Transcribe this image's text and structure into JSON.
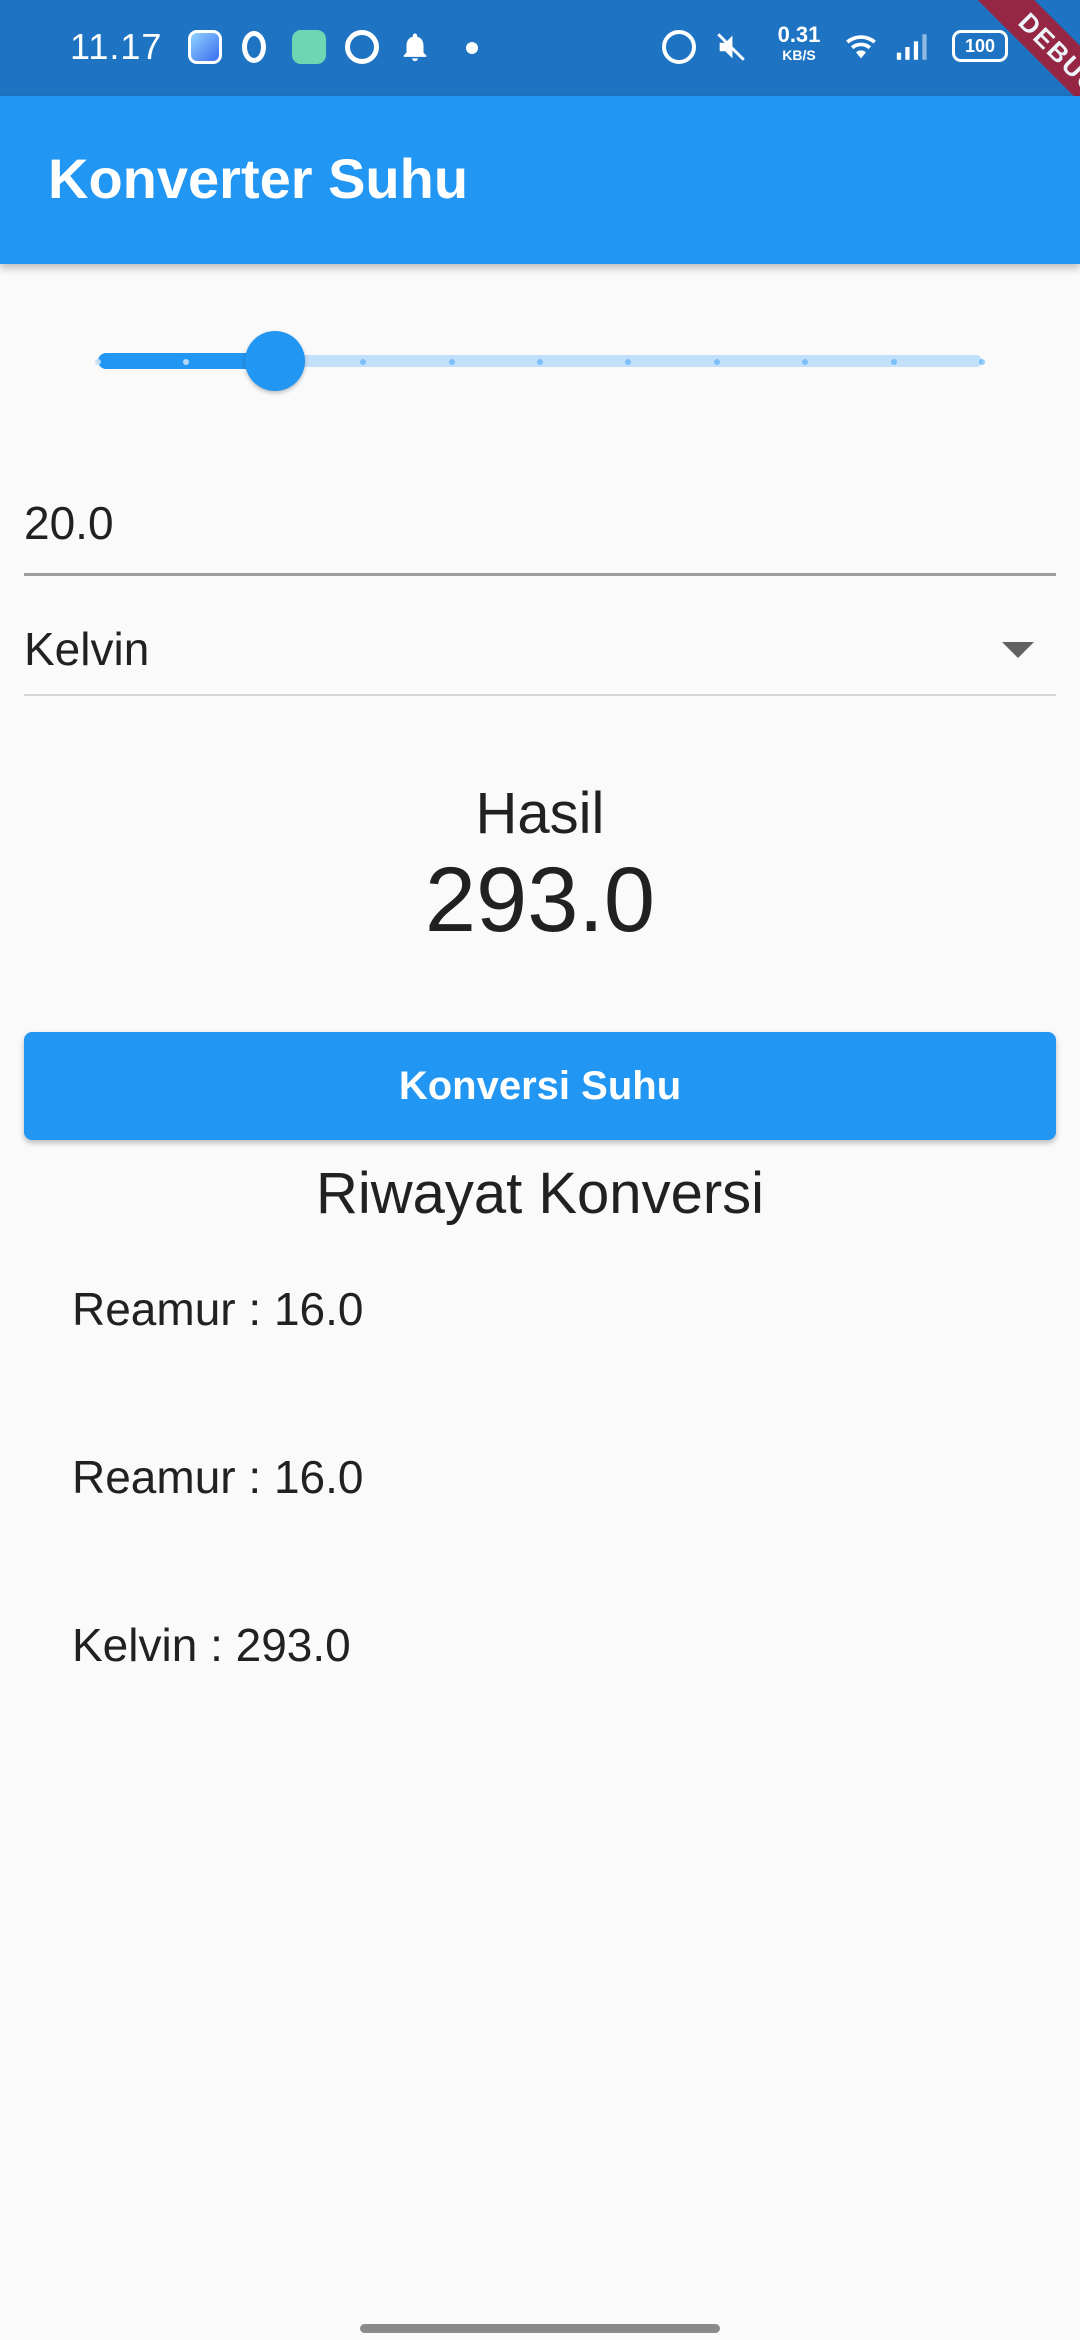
{
  "status_bar": {
    "time": "11.17",
    "net_speed_value": "0.31",
    "net_speed_unit": "KB/S",
    "battery": "100",
    "icons": [
      "app-icon",
      "opera-icon",
      "app-icon",
      "app-icon",
      "bell-icon",
      "dot-icon",
      "alarm-icon",
      "mute-icon",
      "wifi-icon",
      "signal-icon",
      "battery-icon"
    ]
  },
  "debug_banner": "DEBUG",
  "app_bar": {
    "title": "Konverter Suhu"
  },
  "slider": {
    "value": 20,
    "min": 0,
    "max": 100,
    "divisions": 10,
    "active_color": "#2196f3",
    "inactive_color": "#c3e0fb"
  },
  "input": {
    "value": "20.0"
  },
  "unit_dropdown": {
    "selected": "Kelvin"
  },
  "result": {
    "label": "Hasil",
    "value": "293.0"
  },
  "convert_button": {
    "label": "Konversi Suhu"
  },
  "history": {
    "title": "Riwayat Konversi",
    "items": [
      {
        "text": "Reamur : 16.0"
      },
      {
        "text": "Reamur : 16.0"
      },
      {
        "text": "Kelvin : 293.0"
      }
    ]
  },
  "colors": {
    "primary": "#2196f3",
    "status_bar": "#1e74c2",
    "background": "#fafafa",
    "debug_banner": "#a0203a"
  }
}
